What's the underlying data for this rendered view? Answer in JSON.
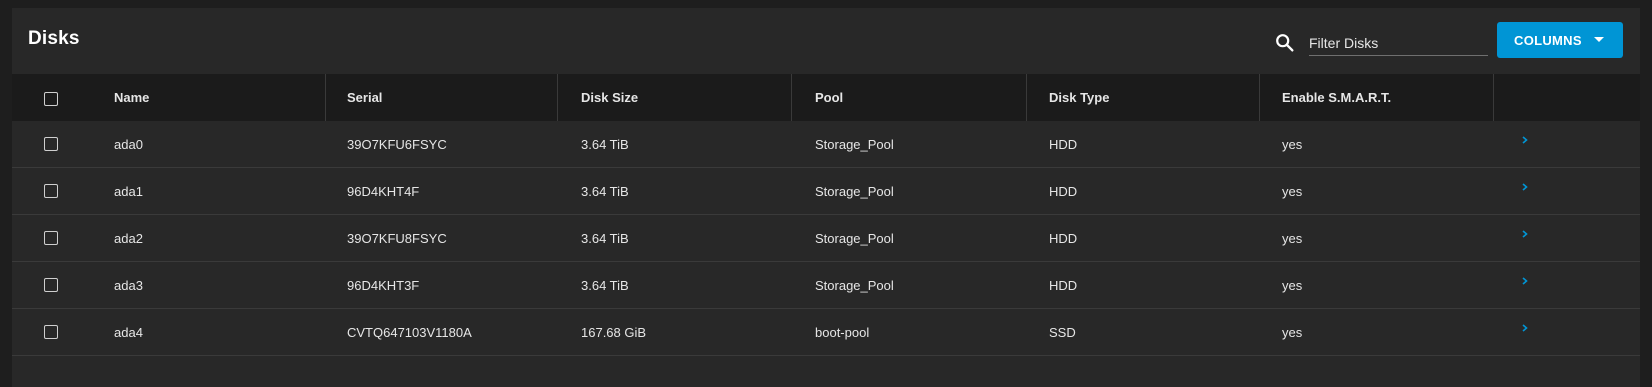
{
  "card": {
    "title": "Disks"
  },
  "search": {
    "placeholder": "Filter Disks",
    "icon": "search-icon"
  },
  "columns_button": {
    "label": "COLUMNS",
    "color": "#0095d5"
  },
  "table": {
    "headers": [
      "Name",
      "Serial",
      "Disk Size",
      "Pool",
      "Disk Type",
      "Enable S.M.A.R.T."
    ],
    "rows": [
      {
        "name": "ada0",
        "serial": "39O7KFU6FSYC",
        "size": "3.64 TiB",
        "pool": "Storage_Pool",
        "type": "HDD",
        "smart": "yes"
      },
      {
        "name": "ada1",
        "serial": "96D4KHT4F",
        "size": "3.64 TiB",
        "pool": "Storage_Pool",
        "type": "HDD",
        "smart": "yes"
      },
      {
        "name": "ada2",
        "serial": "39O7KFU8FSYC",
        "size": "3.64 TiB",
        "pool": "Storage_Pool",
        "type": "HDD",
        "smart": "yes"
      },
      {
        "name": "ada3",
        "serial": "96D4KHT3F",
        "size": "3.64 TiB",
        "pool": "Storage_Pool",
        "type": "HDD",
        "smart": "yes"
      },
      {
        "name": "ada4",
        "serial": "CVTQ647103V1180A",
        "size": "167.68 GiB",
        "pool": "boot-pool",
        "type": "SSD",
        "smart": "yes"
      }
    ]
  },
  "colors": {
    "accent": "#0095d5",
    "background": "#1e1e1e",
    "card": "#282828",
    "header_row": "#1b1b1b"
  }
}
